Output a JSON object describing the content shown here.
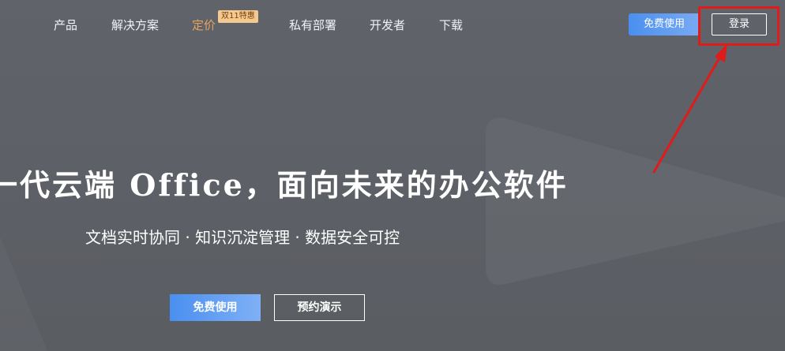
{
  "nav": {
    "items": [
      {
        "label": "产品"
      },
      {
        "label": "解决方案"
      },
      {
        "label": "定价",
        "badge": "双11特惠",
        "active": true
      },
      {
        "label": "私有部署"
      },
      {
        "label": "开发者"
      },
      {
        "label": "下载"
      }
    ],
    "free_button": "免费使用",
    "login_button": "登录"
  },
  "hero": {
    "title": "一代云端 Office，面向未来的办公软件",
    "subtitle": "文档实时协同 · 知识沉淀管理 · 数据安全可控",
    "primary_button": "免费使用",
    "secondary_button": "预约演示"
  },
  "colors": {
    "accent_blue": "#4a8ff0",
    "active_nav": "#e3a35f",
    "badge_bg": "#f3c98f",
    "annotation_red": "#e11a1a",
    "background": "#5d6066"
  }
}
